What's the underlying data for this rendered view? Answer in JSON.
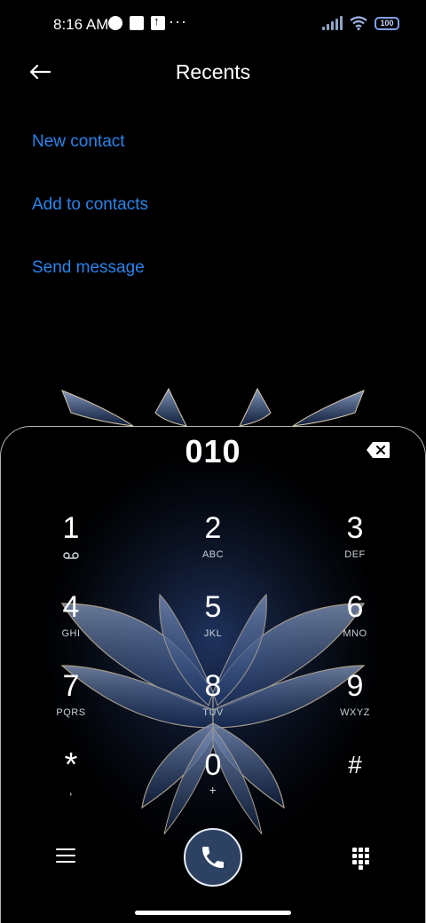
{
  "status_bar": {
    "time": "8:16 AM",
    "more": "···",
    "battery": "100",
    "icons": [
      "notification-circle-icon",
      "square-icon",
      "upload-arrow-icon",
      "signal-icon",
      "wifi-icon",
      "battery-icon"
    ]
  },
  "header": {
    "title": "Recents",
    "back_icon": "back-arrow-icon"
  },
  "actions": [
    {
      "label": "New contact"
    },
    {
      "label": "Add to contacts"
    },
    {
      "label": "Send message"
    }
  ],
  "dialer": {
    "number": "010",
    "delete_icon": "backspace-icon",
    "keys": [
      {
        "digit": "1",
        "letters": ""
      },
      {
        "digit": "2",
        "letters": "ABC"
      },
      {
        "digit": "3",
        "letters": "DEF"
      },
      {
        "digit": "4",
        "letters": "GHI"
      },
      {
        "digit": "5",
        "letters": "JKL"
      },
      {
        "digit": "6",
        "letters": "MNO"
      },
      {
        "digit": "7",
        "letters": "PQRS"
      },
      {
        "digit": "8",
        "letters": "TUV"
      },
      {
        "digit": "9",
        "letters": "WXYZ"
      },
      {
        "digit": "*",
        "letters": ","
      },
      {
        "digit": "0",
        "letters": "+"
      },
      {
        "digit": "#",
        "letters": ""
      }
    ]
  },
  "bottom_bar": {
    "menu_icon": "hamburger-menu-icon",
    "call_icon": "phone-icon",
    "keypad_icon": "dialpad-icon"
  },
  "colors": {
    "accent": "#2b84ea",
    "call_button": "#2d4263",
    "background": "#000000"
  }
}
